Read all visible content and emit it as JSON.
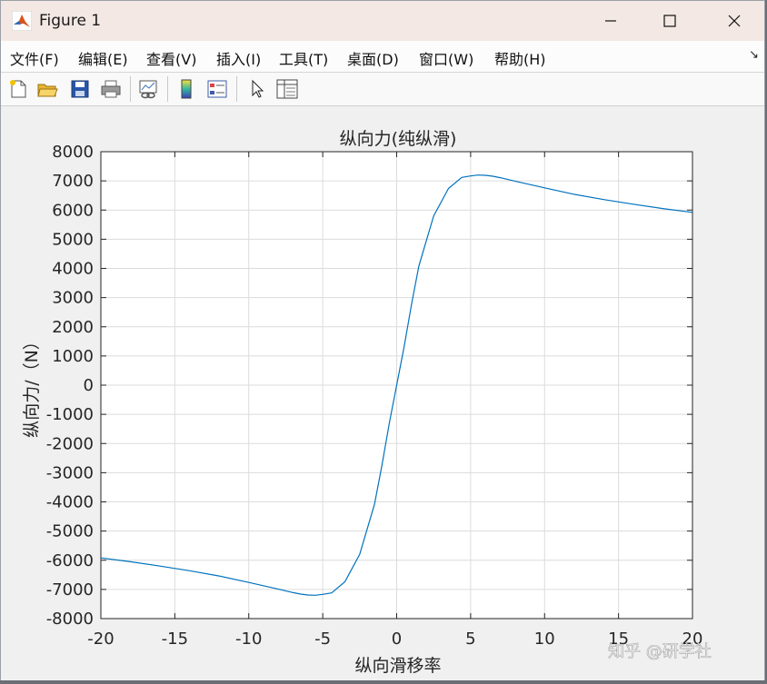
{
  "window": {
    "title": "Figure 1"
  },
  "menu": [
    {
      "label": "文件(F)"
    },
    {
      "label": "编辑(E)"
    },
    {
      "label": "查看(V)"
    },
    {
      "label": "插入(I)"
    },
    {
      "label": "工具(T)"
    },
    {
      "label": "桌面(D)"
    },
    {
      "label": "窗口(W)"
    },
    {
      "label": "帮助(H)"
    }
  ],
  "toolbar": [
    "new-figure-icon",
    "open-file-icon",
    "save-icon",
    "print-icon",
    "link-plot-icon",
    "colorbar-icon",
    "legend-icon",
    "pointer-icon",
    "property-inspector-icon"
  ],
  "watermark": "知乎 @研学社",
  "colors": {
    "line": "#0072BD",
    "grid": "#dcdcdc"
  },
  "chart_data": {
    "type": "line",
    "title": "纵向力(纯纵滑)",
    "xlabel": "纵向滑移率",
    "ylabel": "纵向力/（N）",
    "xlim": [
      -20,
      20
    ],
    "ylim": [
      -8000,
      8000
    ],
    "xticks": [
      "-20",
      "-15",
      "-10",
      "-5",
      "0",
      "5",
      "10",
      "15",
      "20"
    ],
    "yticks": [
      "-8000",
      "-7000",
      "-6000",
      "-5000",
      "-4000",
      "-3000",
      "-2000",
      "-1000",
      "0",
      "1000",
      "2000",
      "3000",
      "4000",
      "5000",
      "6000",
      "7000",
      "8000"
    ],
    "grid": true,
    "series": [
      {
        "x": [
          -20,
          -18,
          -16,
          -14,
          -12,
          -10,
          -8,
          -7,
          -6.5,
          -6,
          -5.5,
          -5,
          -4.4,
          -3.5,
          -2.5,
          -1.5,
          -1,
          -0.5,
          0,
          0.5,
          1,
          1.5,
          2.5,
          3.5,
          4.4,
          5,
          5.5,
          6,
          6.5,
          7,
          8,
          10,
          12,
          14,
          16,
          18,
          20
        ],
        "y": [
          -5920,
          -6050,
          -6200,
          -6360,
          -6540,
          -6760,
          -6990,
          -7110,
          -7160,
          -7190,
          -7200,
          -7170,
          -7120,
          -6740,
          -5800,
          -4080,
          -2760,
          -1300,
          0,
          1300,
          2760,
          4080,
          5800,
          6740,
          7120,
          7170,
          7200,
          7190,
          7160,
          7110,
          6990,
          6760,
          6540,
          6360,
          6200,
          6050,
          5920
        ]
      }
    ]
  }
}
